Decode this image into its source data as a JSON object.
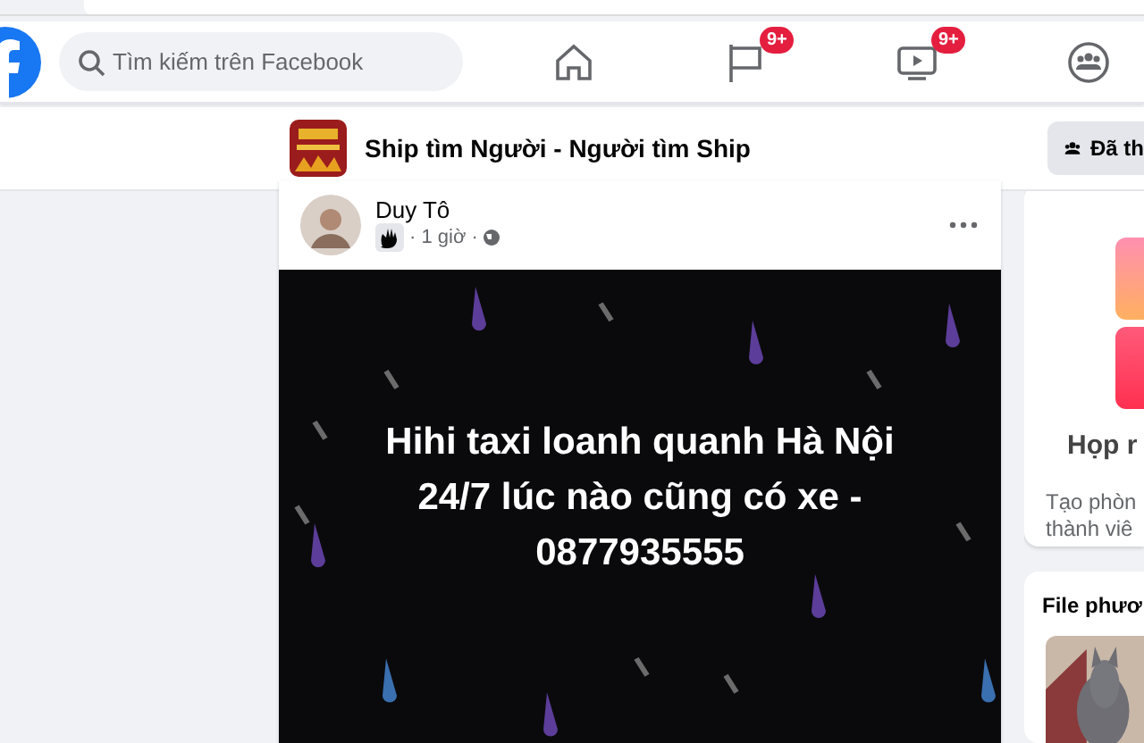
{
  "header": {
    "search": {
      "placeholder": "Tìm kiếm trên Facebook"
    },
    "nav": [
      {
        "kind": "home",
        "selected": false
      },
      {
        "kind": "flag",
        "badge": "9+",
        "selected": false
      },
      {
        "kind": "video",
        "badge": "9+",
        "selected": false
      },
      {
        "kind": "groups",
        "selected": false
      }
    ]
  },
  "group_bar": {
    "title": "Ship tìm Người - Người tìm Ship",
    "joined_button": "Đã th"
  },
  "post": {
    "author": "Duy Tô",
    "time": "· 1 giờ ·",
    "text": "Hihi taxi loanh quanh Hà Nội 24/7 lúc nào cũng có xe - 0877935555"
  },
  "sidebar": {
    "room_title": "Họp r",
    "room_text": [
      "Tạo phòn",
      "thành viê"
    ],
    "files_title": "File phươ"
  }
}
